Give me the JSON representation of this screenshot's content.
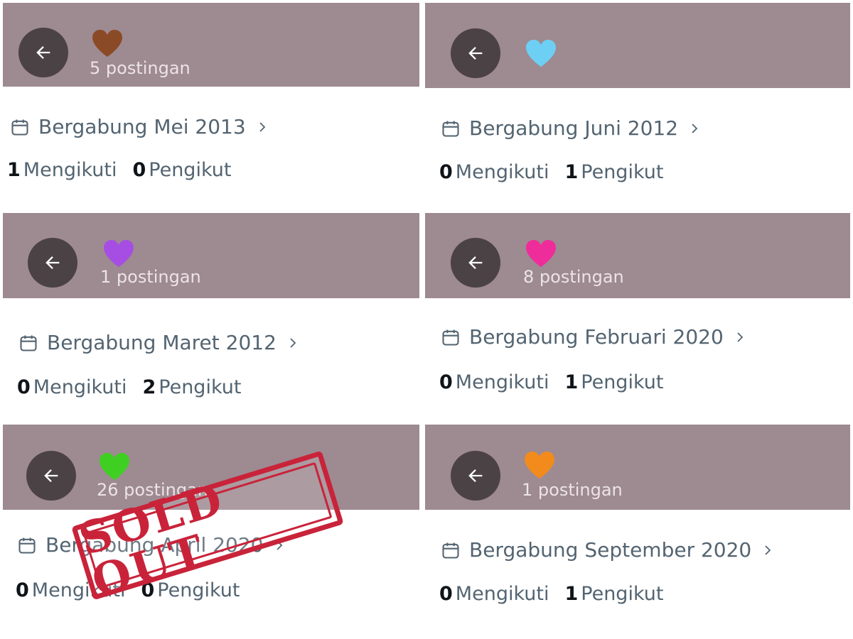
{
  "cards": [
    {
      "heart_color": "#8b4a26",
      "posts": "5 postingan",
      "joined": "Bergabung Mei 2013",
      "following_count": "1",
      "following_label": "Mengikuti",
      "followers_count": "0",
      "followers_label": "Pengikut"
    },
    {
      "heart_color": "#6ecff5",
      "posts": "",
      "joined": "Bergabung Juni 2012",
      "following_count": "0",
      "following_label": "Mengikuti",
      "followers_count": "1",
      "followers_label": "Pengikut"
    },
    {
      "heart_color": "#a64ee3",
      "posts": "1 postingan",
      "joined": "Bergabung Maret 2012",
      "following_count": "0",
      "following_label": "Mengikuti",
      "followers_count": "2",
      "followers_label": "Pengikut"
    },
    {
      "heart_color": "#ee2d9a",
      "posts": "8 postingan",
      "joined": "Bergabung Februari 2020",
      "following_count": "0",
      "following_label": "Mengikuti",
      "followers_count": "1",
      "followers_label": "Pengikut"
    },
    {
      "heart_color": "#3fcf22",
      "posts": "26 postingan",
      "joined": "Bergabung April 2020",
      "following_count": "0",
      "following_label": "Mengikuti",
      "followers_count": "0",
      "followers_label": "Pengikut"
    },
    {
      "heart_color": "#f28b1c",
      "posts": "1 postingan",
      "joined": "Bergabung September 2020",
      "following_count": "0",
      "following_label": "Mengikuti",
      "followers_count": "1",
      "followers_label": "Pengikut"
    }
  ],
  "stamp": {
    "text": "SOLD OUT",
    "color": "#c9233a"
  },
  "icons": {
    "back": "arrow-left-icon",
    "calendar": "calendar-icon",
    "chevron": "chevron-right-icon",
    "heart": "heart-icon"
  },
  "colors": {
    "banner": "#9e8a91",
    "back_button": "#4b4245",
    "text_muted": "#536471",
    "text_strong": "#0f1419"
  }
}
